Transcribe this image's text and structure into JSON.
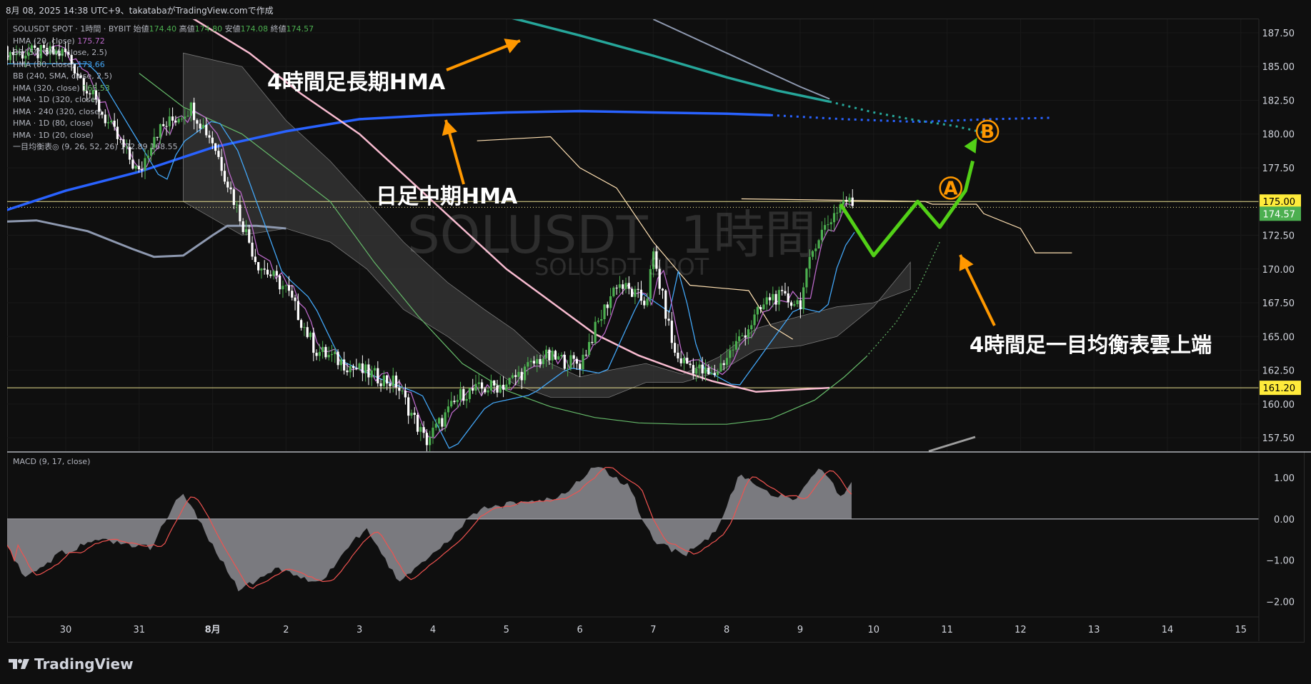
{
  "header": {
    "caption": "8月 08, 2025 14:38 UTC+9、takatabaがTradingView.comで作成"
  },
  "watermark": {
    "title": "SOLUSDT, 1時間",
    "subtitle": "SOLUSDT SPOT"
  },
  "legend": {
    "symbol_line": "SOLUSDT SPOT · 1時間 · BYBIT",
    "ohlc": [
      {
        "label": "始値",
        "value": "174.40"
      },
      {
        "label": "高値",
        "value": "174.80"
      },
      {
        "label": "安値",
        "value": "174.08"
      },
      {
        "label": "終値",
        "value": "174.57"
      }
    ],
    "indicators": [
      {
        "name": "HMA (20, close)",
        "value": "175.72"
      },
      {
        "name": "BB (50, SMA, close, 2.5)",
        "value": ""
      },
      {
        "name": "HMA (80, close)",
        "value": "173.66"
      },
      {
        "name": "BB (240, SMA, close, 2.5)",
        "value": ""
      },
      {
        "name": "HMA (320, close)",
        "value": "163.53"
      },
      {
        "name": "HMA · 1D (320, close)",
        "value": ""
      },
      {
        "name": "HMA · 240 (320, close)",
        "value": ""
      },
      {
        "name": "HMA · 1D (80, close)",
        "value": ""
      },
      {
        "name": "HMA · 1D (20, close)",
        "value": ""
      },
      {
        "name": "一目均衡表◎ (9, 26, 52, 26)",
        "value": "172.89  168.55"
      }
    ]
  },
  "annotations": {
    "four_hour_long_hma": "4時間足長期HMA",
    "daily_mid_hma": "日足中期HMA",
    "cloud_top": "4時間足一目均衡表雲上端",
    "point_a": "A",
    "point_b": "B"
  },
  "macd_label": "MACD (9, 17, close)",
  "brand": "TradingView",
  "colors": {
    "background": "#0f0f0f",
    "up_candle": "#4caf50",
    "down_candle": "#ffffff",
    "hma20": "#ba68c8",
    "hma80": "#42a5f5",
    "daily_mid_hma": "#2962ff",
    "four_hour_long_hma": "#26a69a",
    "pink_line": "#f8bbd0",
    "bb240": "#8e99b0",
    "green_curve": "#66bb6a",
    "lagging_line": "#ffe0b2",
    "forecast": "#52d017",
    "arrow": "#ff9800",
    "level_badge": "#ffeb3b",
    "price_badge": "#4caf50"
  },
  "chart_data": {
    "type": "candlestick",
    "symbol": "SOLUSDT SPOT",
    "interval": "1時間",
    "exchange": "BYBIT",
    "y_axis": {
      "ticks": [
        "187.50",
        "185.00",
        "182.50",
        "180.00",
        "177.50",
        "175.00",
        "172.50",
        "170.00",
        "167.50",
        "165.00",
        "162.50",
        "160.00",
        "157.50"
      ],
      "ylim": [
        156.5,
        188.5
      ]
    },
    "x_axis": {
      "ticks": [
        "30",
        "31",
        "8月",
        "2",
        "3",
        "4",
        "5",
        "6",
        "7",
        "8",
        "9",
        "10",
        "11",
        "12",
        "13",
        "14",
        "15"
      ]
    },
    "horizontal_levels": [
      {
        "value": 175.0,
        "label": "175.00",
        "color": "#fff59d"
      },
      {
        "value": 161.2,
        "label": "161.20",
        "color": "#fff59d"
      }
    ],
    "last_price": {
      "value": 174.57,
      "label": "174.57"
    },
    "price_path": [
      {
        "x": 0,
        "y": 186.0
      },
      {
        "x": 0.5,
        "y": 181.5
      },
      {
        "x": 1.0,
        "y": 177.0
      },
      {
        "x": 1.2,
        "y": 180.0
      },
      {
        "x": 1.7,
        "y": 182.0
      },
      {
        "x": 2.0,
        "y": 179.5
      },
      {
        "x": 2.2,
        "y": 176.5
      },
      {
        "x": 2.6,
        "y": 170.5
      },
      {
        "x": 3.0,
        "y": 168.5
      },
      {
        "x": 3.4,
        "y": 164.0
      },
      {
        "x": 4.0,
        "y": 162.5
      },
      {
        "x": 4.5,
        "y": 161.5
      },
      {
        "x": 4.9,
        "y": 157.2
      },
      {
        "x": 5.4,
        "y": 160.8
      },
      {
        "x": 6.0,
        "y": 161.5
      },
      {
        "x": 6.5,
        "y": 163.5
      },
      {
        "x": 7.0,
        "y": 163.0
      },
      {
        "x": 7.5,
        "y": 169.0
      },
      {
        "x": 7.9,
        "y": 167.5
      },
      {
        "x": 8.0,
        "y": 171.0
      },
      {
        "x": 8.3,
        "y": 163.5
      },
      {
        "x": 8.8,
        "y": 162.0
      },
      {
        "x": 9.2,
        "y": 165.0
      },
      {
        "x": 9.6,
        "y": 168.0
      },
      {
        "x": 10.0,
        "y": 167.5
      },
      {
        "x": 10.2,
        "y": 172.0
      },
      {
        "x": 10.6,
        "y": 175.2
      },
      {
        "x": 10.75,
        "y": 174.6
      }
    ],
    "macd": {
      "label": "MACD (9, 17, close)",
      "ticks": [
        "1.00",
        "0.00",
        "−1.00",
        "−2.00"
      ],
      "ylim": [
        -2.3,
        1.5
      ],
      "histogram": [
        {
          "x": 0,
          "y": -0.3
        },
        {
          "x": 0.3,
          "y": -1.4
        },
        {
          "x": 0.8,
          "y": -0.8
        },
        {
          "x": 1.3,
          "y": -0.5
        },
        {
          "x": 1.9,
          "y": -0.7
        },
        {
          "x": 2.3,
          "y": 0.7
        },
        {
          "x": 2.6,
          "y": -0.4
        },
        {
          "x": 3.0,
          "y": -1.7
        },
        {
          "x": 3.5,
          "y": -1.2
        },
        {
          "x": 4.0,
          "y": -1.6
        },
        {
          "x": 4.6,
          "y": -0.2
        },
        {
          "x": 5.0,
          "y": -1.5
        },
        {
          "x": 5.5,
          "y": -0.8
        },
        {
          "x": 6.0,
          "y": 0.2
        },
        {
          "x": 6.5,
          "y": 0.4
        },
        {
          "x": 7.0,
          "y": 0.5
        },
        {
          "x": 7.5,
          "y": 1.3
        },
        {
          "x": 7.9,
          "y": 0.8
        },
        {
          "x": 8.2,
          "y": -0.5
        },
        {
          "x": 8.6,
          "y": -0.9
        },
        {
          "x": 9.0,
          "y": -0.3
        },
        {
          "x": 9.3,
          "y": 1.1
        },
        {
          "x": 9.7,
          "y": 0.6
        },
        {
          "x": 10.0,
          "y": 0.5
        },
        {
          "x": 10.3,
          "y": 1.2
        },
        {
          "x": 10.6,
          "y": 0.5
        },
        {
          "x": 10.75,
          "y": 1.1
        }
      ]
    }
  }
}
